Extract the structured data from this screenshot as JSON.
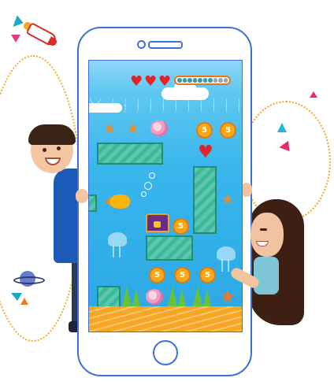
{
  "hud": {
    "lives": 3,
    "heart_icon": "heart-icon",
    "progress_dots_total": 10,
    "progress_dots_filled": 7,
    "progress_fraction": 0.7
  },
  "coins": {
    "coin_glyph": "5",
    "icon": "coin-icon"
  },
  "colors": {
    "phone_outline": "#3f6fd8",
    "water": "#2aa7e4",
    "platform": "#3cb99c",
    "sand": "#f6a623",
    "heart": "#e0242b",
    "star": "#f58a1f",
    "coin": "#f7a81b",
    "chest": "#6b2a83"
  },
  "icons": {
    "home_button": "home-button-icon",
    "star": "star-icon",
    "shell": "seashell-icon",
    "chest": "treasure-chest-icon",
    "lock": "lock-icon",
    "fish": "fish-icon",
    "jellyfish": "jellyfish-icon",
    "rocket": "rocket-icon",
    "planet": "planet-icon"
  }
}
